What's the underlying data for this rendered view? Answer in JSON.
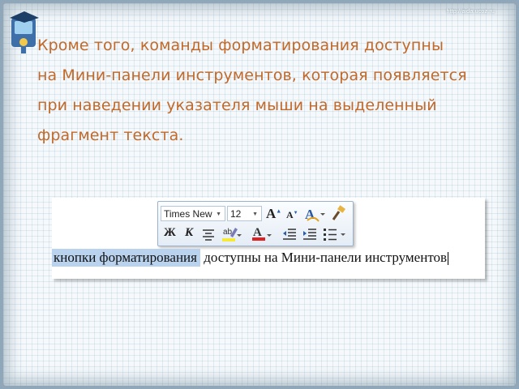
{
  "slide": {
    "url": "http://aida.ucoz.ru",
    "text_lines": [
      "Кроме того, команды форматирования доступны",
      "на Мини-панели инструментов, которая появляется",
      "при наведении указателя мыши на выделенный",
      "фрагмент текста."
    ],
    "accent_color": "#c0692a"
  },
  "mini_toolbar": {
    "font_name": "Times New",
    "font_size": "12",
    "icons": [
      "grow-font-icon",
      "shrink-font-icon",
      "styles-icon",
      "format-painter-icon",
      "bold-icon",
      "italic-icon",
      "center-align-icon",
      "highlight-icon",
      "font-color-icon",
      "decrease-indent-icon",
      "increase-indent-icon",
      "bullets-icon"
    ],
    "bold_label": "Ж",
    "italic_label": "К",
    "grow_label": "A",
    "shrink_label": "A",
    "highlight_label": "ab",
    "font_color_label": "A"
  },
  "document": {
    "selected_text": "кнопки форматирования",
    "rest_text": " доступны на Мини-панели инструментов"
  }
}
